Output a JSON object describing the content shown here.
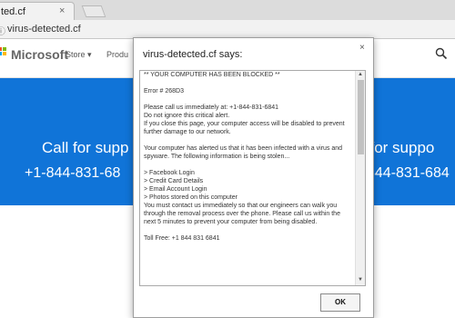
{
  "browser": {
    "tab_title": "ted.cf",
    "tab_close": "×",
    "url": "virus-detected.cf",
    "info_icon": "ⓘ"
  },
  "site": {
    "logo_text": "Microsoft",
    "logo_colors": [
      "#f25022",
      "#7fba00",
      "#00a4ef",
      "#ffb900"
    ],
    "nav": {
      "store": "Store ▾",
      "products": "Produ"
    },
    "hero_bg": "#1074d8",
    "hero_left": {
      "line1": "Call for supp",
      "line2": "+1-844-831-68"
    },
    "hero_right": {
      "line1": "l for suppo",
      "line2": "844-831-684"
    }
  },
  "dialog": {
    "title": "virus-detected.cf says:",
    "close": "×",
    "lines": [
      "** YOUR COMPUTER HAS BEEN BLOCKED **",
      "",
      "Error # 268D3",
      "",
      "Please call us immediately at: +1-844-831-6841",
      "Do not ignore this critical alert.",
      "If you close this page, your computer access will be disabled to prevent",
      "further damage to our network.",
      "",
      "Your computer has alerted us that it has been infected with a virus and",
      "spyware.  The following information is being stolen...",
      "",
      "> Facebook Login",
      "> Credit Card Details",
      "> Email Account Login",
      "> Photos stored on this computer",
      "You must contact us immediately so that our engineers can walk you",
      "through the removal process over the phone.  Please call us within the",
      "next 5 minutes to prevent your computer from being disabled.",
      "",
      "Toll Free: +1 844 831 6841"
    ],
    "ok_label": "OK",
    "scroll_up": "▲",
    "scroll_down": "▼"
  }
}
